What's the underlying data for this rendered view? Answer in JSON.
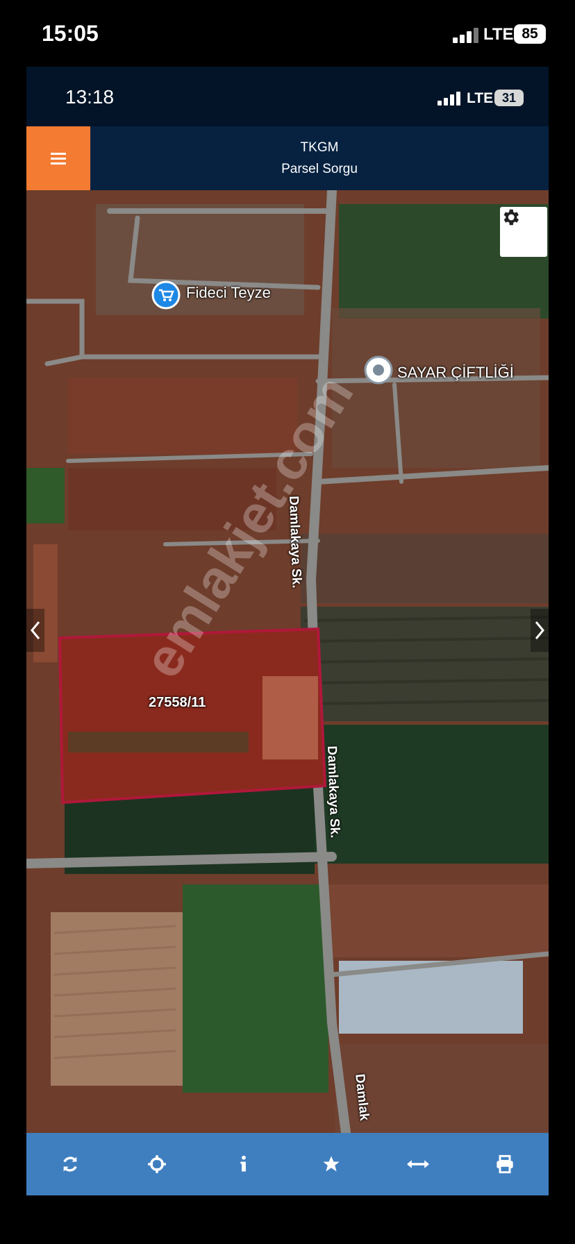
{
  "outer_status": {
    "time": "15:05",
    "network": "LTE",
    "battery": "85"
  },
  "inner_status": {
    "time": "13:18",
    "network": "LTE",
    "battery": "31"
  },
  "header": {
    "title": "TKGM",
    "subtitle": "Parsel Sorgu",
    "menu_icon": "hamburger-icon"
  },
  "map": {
    "pois": [
      {
        "name": "Fideci Teyze",
        "icon": "shopping-cart-icon"
      },
      {
        "name": "SAYAR ÇİFTLİĞİ",
        "icon": "place-pin-icon"
      }
    ],
    "roads": [
      "Damlakaya Sk.",
      "Damlakaya Sk.",
      "Damlak"
    ],
    "parcel": {
      "id": "27558/11",
      "border_color": "#b0183a"
    },
    "watermark": "emlakjet.com"
  },
  "toolbar": [
    {
      "name": "refresh",
      "icon": "refresh-icon"
    },
    {
      "name": "locate",
      "icon": "crosshair-icon"
    },
    {
      "name": "info",
      "icon": "info-icon"
    },
    {
      "name": "favorite",
      "icon": "star-icon"
    },
    {
      "name": "measure",
      "icon": "arrows-horizontal-icon"
    },
    {
      "name": "print",
      "icon": "print-icon"
    }
  ],
  "colors": {
    "menu_button": "#f47b32",
    "header": "#072241",
    "toolbar": "#3f7fc0"
  }
}
